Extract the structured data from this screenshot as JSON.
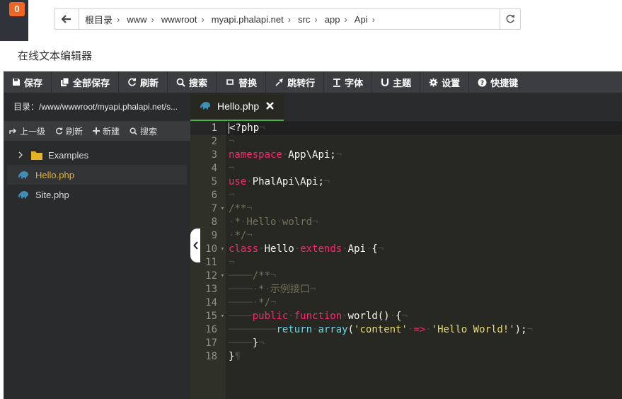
{
  "background": {
    "badge_count": "0",
    "path": {
      "crumbs": [
        "根目录",
        "www",
        "wwwroot",
        "myapi.phalapi.net",
        "src",
        "app",
        "Api"
      ]
    }
  },
  "editor": {
    "title": "在线文本编辑器",
    "toolbar": [
      {
        "label": "保存",
        "icon": "save-icon"
      },
      {
        "label": "全部保存",
        "icon": "save-all-icon"
      },
      {
        "label": "刷新",
        "icon": "refresh-icon"
      },
      {
        "label": "搜索",
        "icon": "search-icon"
      },
      {
        "label": "替换",
        "icon": "replace-icon"
      },
      {
        "label": "跳转行",
        "icon": "goto-line-icon"
      },
      {
        "label": "字体",
        "icon": "font-icon"
      },
      {
        "label": "主题",
        "icon": "theme-icon"
      },
      {
        "label": "设置",
        "icon": "settings-icon"
      },
      {
        "label": "快捷键",
        "icon": "help-icon"
      }
    ],
    "sidebar": {
      "directory": "目录：/www/wwwroot/myapi.phalapi.net/s...",
      "actions": [
        {
          "label": "上一级",
          "icon": "up-level-icon"
        },
        {
          "label": "刷新",
          "icon": "refresh-icon"
        },
        {
          "label": "新建",
          "icon": "plus-icon"
        },
        {
          "label": "搜索",
          "icon": "search-icon"
        }
      ],
      "tree": [
        {
          "label": "Examples",
          "type": "folder"
        },
        {
          "label": "Hello.php",
          "type": "php",
          "selected": true
        },
        {
          "label": "Site.php",
          "type": "php"
        }
      ]
    },
    "tab": {
      "label": "Hello.php"
    },
    "line_numbers": [
      "1",
      "2",
      "3",
      "4",
      "5",
      "6",
      "7",
      "8",
      "9",
      "10",
      "11",
      "12",
      "13",
      "14",
      "15",
      "16",
      "17",
      "18"
    ],
    "colors": {
      "accent_tab": "#4caf50",
      "keyword": "#f92672",
      "string": "#e6db74",
      "comment": "#75715e",
      "selected_file": "#e6b422"
    }
  }
}
